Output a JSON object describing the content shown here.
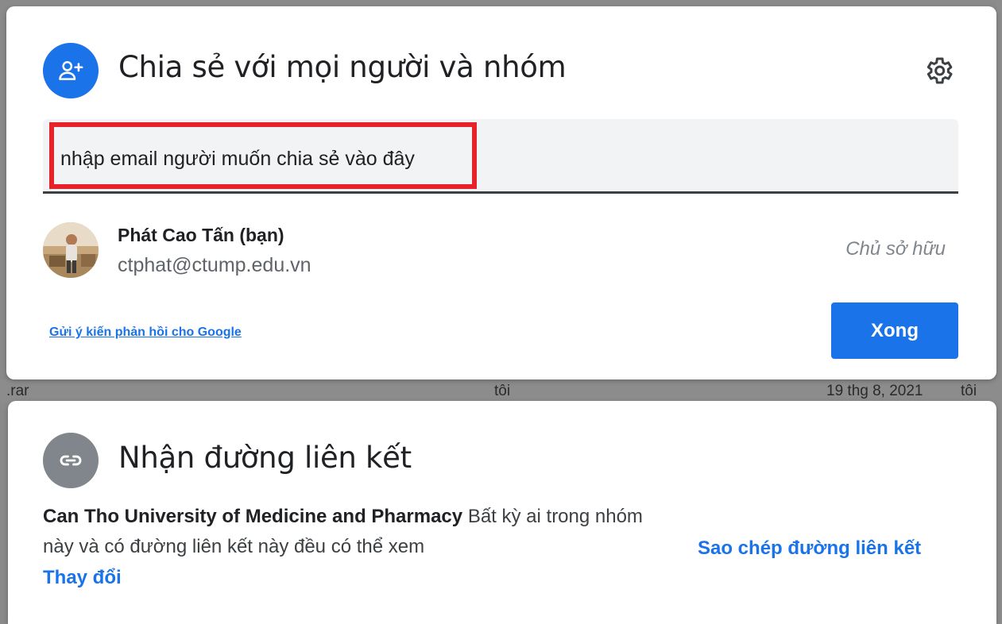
{
  "background": {
    "row": {
      "name": ".rar",
      "owner": "tôi",
      "date": "19 thg 8, 2021",
      "modified_by": "tôi"
    }
  },
  "share_dialog": {
    "title": "Chia sẻ với mọi người và nhóm",
    "icon": "person-add-icon",
    "settings_icon": "gear-icon",
    "email_input": {
      "value": "",
      "placeholder": "nhập email người muốn chia sẻ vào đây"
    },
    "owner": {
      "name": "Phát Cao Tấn (bạn)",
      "email": "ctphat@ctump.edu.vn",
      "role": "Chủ sở hữu"
    },
    "feedback_link": "Gửi ý kiến phản hồi cho Google",
    "done_button": "Xong"
  },
  "link_dialog": {
    "title": "Nhận đường liên kết",
    "icon": "link-icon",
    "organization": "Can Tho University of Medicine and Pharmacy",
    "description": "Bất kỳ ai trong nhóm này và có đường liên kết này đều có thể xem",
    "change_link": "Thay đổi",
    "copy_link": "Sao chép đường liên kết"
  },
  "colors": {
    "accent": "#1a73e8",
    "highlight": "#e8222a",
    "overlay": "#8c8c8c"
  }
}
